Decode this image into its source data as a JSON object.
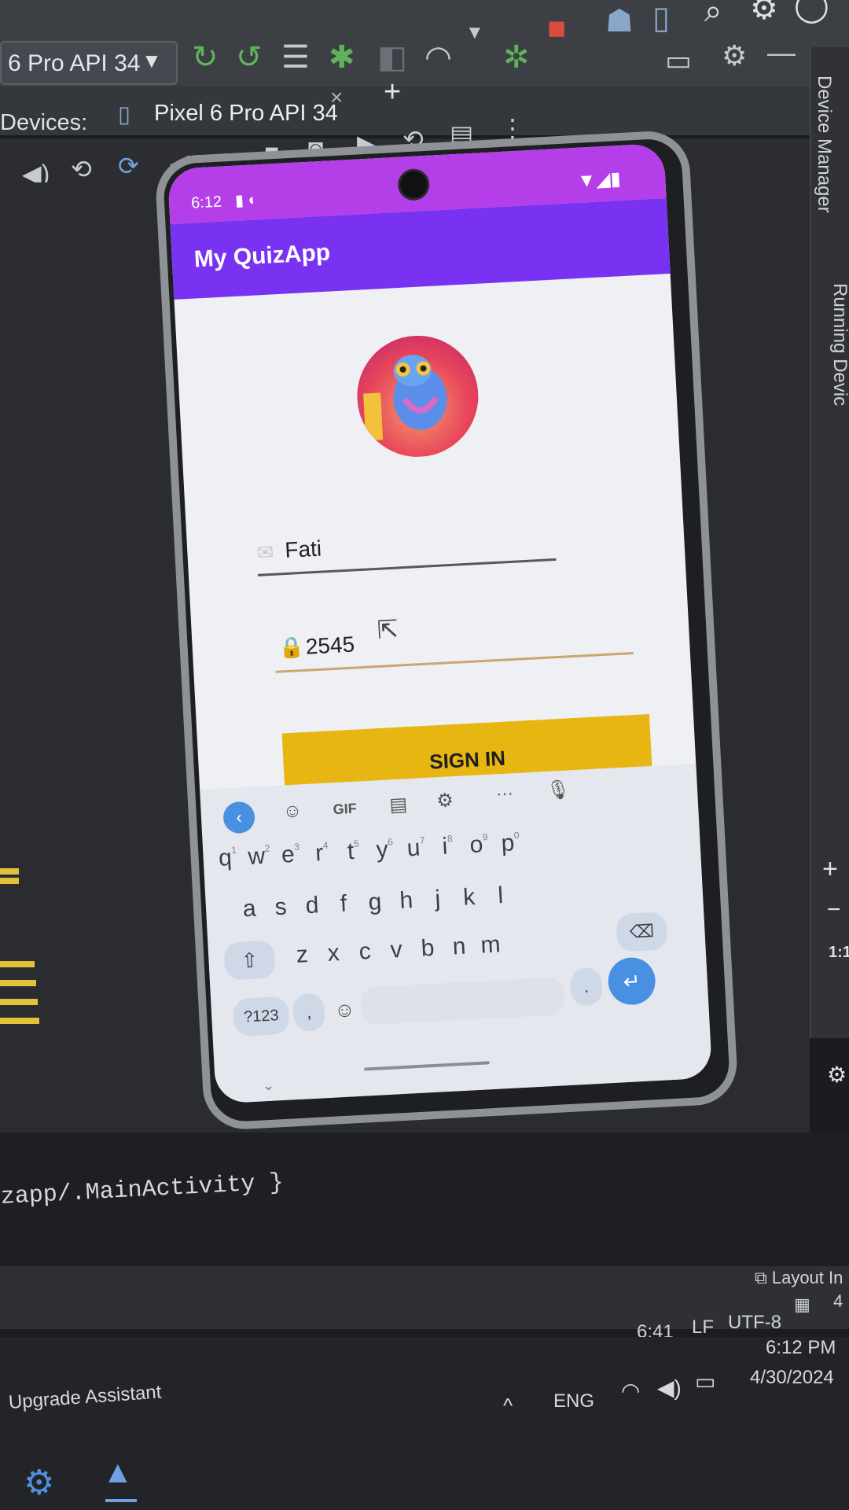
{
  "ide": {
    "device_selector": "6 Pro API 34",
    "devices_label": "Devices:",
    "device_tab": "Pixel 6 Pro API 34",
    "tab_close": "×",
    "tab_add": "+",
    "side_panel_top": "Device Manager",
    "side_panel_bottom": "Running Devic",
    "zoom_plus": "+",
    "zoom_minus": "−",
    "zoom_ratio": "1:1",
    "console_line": "zapp/.MainActivity }",
    "layout_inspector": "Layout In",
    "cursor_pos": "6:41",
    "line_ending": "LF",
    "encoding": "UTF-8",
    "indent": "4",
    "upgrade_assistant": "Upgrade Assistant"
  },
  "taskbar": {
    "language": "ENG",
    "time": "6:12 PM",
    "date": "4/30/2024"
  },
  "phone": {
    "status_time": "6:12",
    "app_title": "My QuizApp",
    "email_value": "Fati",
    "password_value": "2545",
    "signin_label": "SIGN IN",
    "colors": {
      "status_bar": "#b43ee8",
      "app_bar": "#7a32f2",
      "signin_button": "#e8b612"
    }
  },
  "keyboard": {
    "toolbar": [
      "GIF",
      "···"
    ],
    "row1": [
      {
        "k": "q",
        "s": "1"
      },
      {
        "k": "w",
        "s": "2"
      },
      {
        "k": "e",
        "s": "3"
      },
      {
        "k": "r",
        "s": "4"
      },
      {
        "k": "t",
        "s": "5"
      },
      {
        "k": "y",
        "s": "6"
      },
      {
        "k": "u",
        "s": "7"
      },
      {
        "k": "i",
        "s": "8"
      },
      {
        "k": "o",
        "s": "9"
      },
      {
        "k": "p",
        "s": "0"
      }
    ],
    "row2": [
      "a",
      "s",
      "d",
      "f",
      "g",
      "h",
      "j",
      "k",
      "l"
    ],
    "row3": [
      "z",
      "x",
      "c",
      "v",
      "b",
      "n",
      "m"
    ],
    "numbers_key": "?123",
    "comma_key": ",",
    "period_key": "."
  }
}
